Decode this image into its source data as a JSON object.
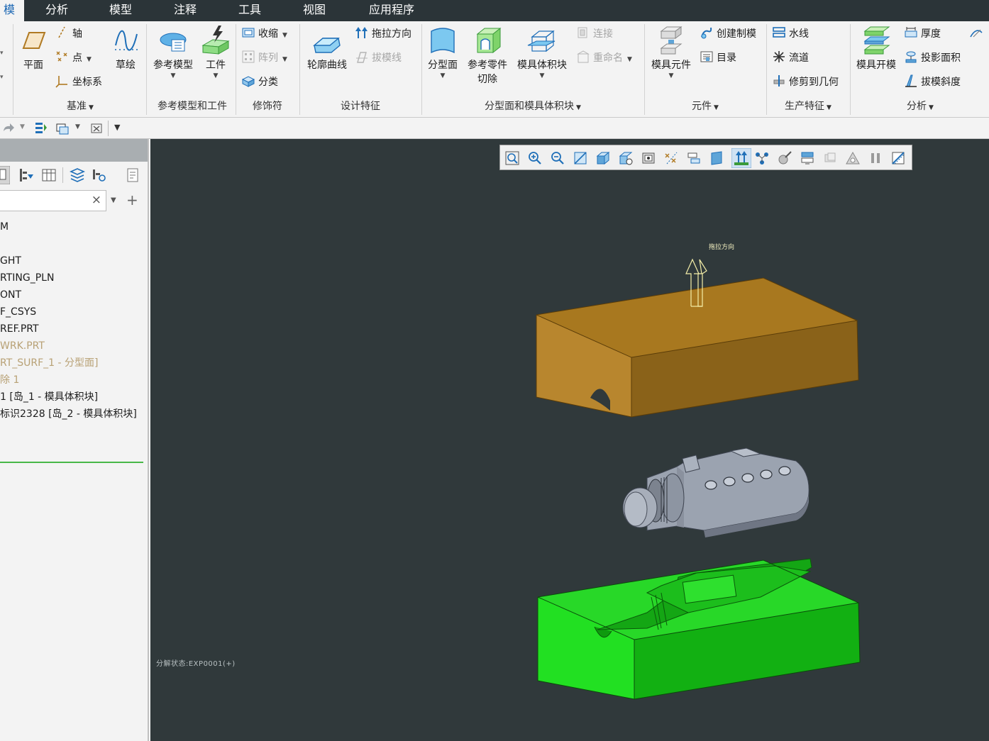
{
  "menubar": {
    "tabs": [
      {
        "label": "模",
        "active": true
      },
      {
        "label": "分析",
        "active": false
      },
      {
        "label": "模型",
        "active": false
      },
      {
        "label": "注释",
        "active": false
      },
      {
        "label": "工具",
        "active": false
      },
      {
        "label": "视图",
        "active": false
      },
      {
        "label": "应用程序",
        "active": false
      }
    ]
  },
  "ribbon": {
    "datum": {
      "plane": "平面",
      "axis": "轴",
      "point": "点",
      "csys": "坐标系",
      "sketch": "草绘",
      "group_label": "基准"
    },
    "ref_model": {
      "ref_model": "参考模型",
      "workpiece": "工件",
      "group_label": "参考模型和工件"
    },
    "decoration": {
      "shrink": "收缩",
      "pattern": "阵列",
      "classify": "分类",
      "group_label": "修饰符"
    },
    "design": {
      "silhouette": "轮廓曲线",
      "pull_dir": "拖拉方向",
      "draft_line": "拔模线",
      "group_label": "设计特征"
    },
    "parting": {
      "parting_surface": "分型面",
      "ref_part_cut_1": "参考零件",
      "ref_part_cut_2": "切除",
      "mold_volume": "模具体积块",
      "connect": "连接",
      "rename": "重命名",
      "group_label": "分型面和模具体积块"
    },
    "component": {
      "mold_component": "模具元件",
      "create_molding": "创建制模",
      "catalog": "目录",
      "group_label": "元件"
    },
    "production": {
      "waterline": "水线",
      "runner": "流道",
      "trim_geom": "修剪到几何",
      "group_label": "生产特征"
    },
    "analysis": {
      "mold_open": "模具开模",
      "thickness": "厚度",
      "proj_area": "投影面积",
      "draft_check": "拔模斜度",
      "group_label": "分析"
    }
  },
  "tree": {
    "items": [
      {
        "label": "M",
        "dim": false
      },
      {
        "label": "",
        "dim": false
      },
      {
        "label": "GHT",
        "dim": false
      },
      {
        "label": "RTING_PLN",
        "dim": false
      },
      {
        "label": "ONT",
        "dim": false
      },
      {
        "label": "F_CSYS",
        "dim": false
      },
      {
        "label": "REF.PRT",
        "dim": false
      },
      {
        "label": "WRK.PRT",
        "dim": true
      },
      {
        "label": "RT_SURF_1 - 分型面]",
        "dim": true
      },
      {
        "label": "除 1",
        "dim": true
      },
      {
        "label": " 1 [岛_1 - 模具体积块]",
        "dim": false
      },
      {
        "label": " 标识2328 [岛_2 - 模具体积块]",
        "dim": false
      }
    ]
  },
  "viewport": {
    "drag_direction_label": "拖拉方向",
    "explode_state_label": "分解状态:EXP0001(+)"
  },
  "colors": {
    "menubar": "#2b3438",
    "viewport_bg": "#30393b",
    "upper_mold": "#b8862e",
    "lower_mold": "#22e022",
    "part": "#9aa1ad",
    "accent": "#1a66b3"
  }
}
